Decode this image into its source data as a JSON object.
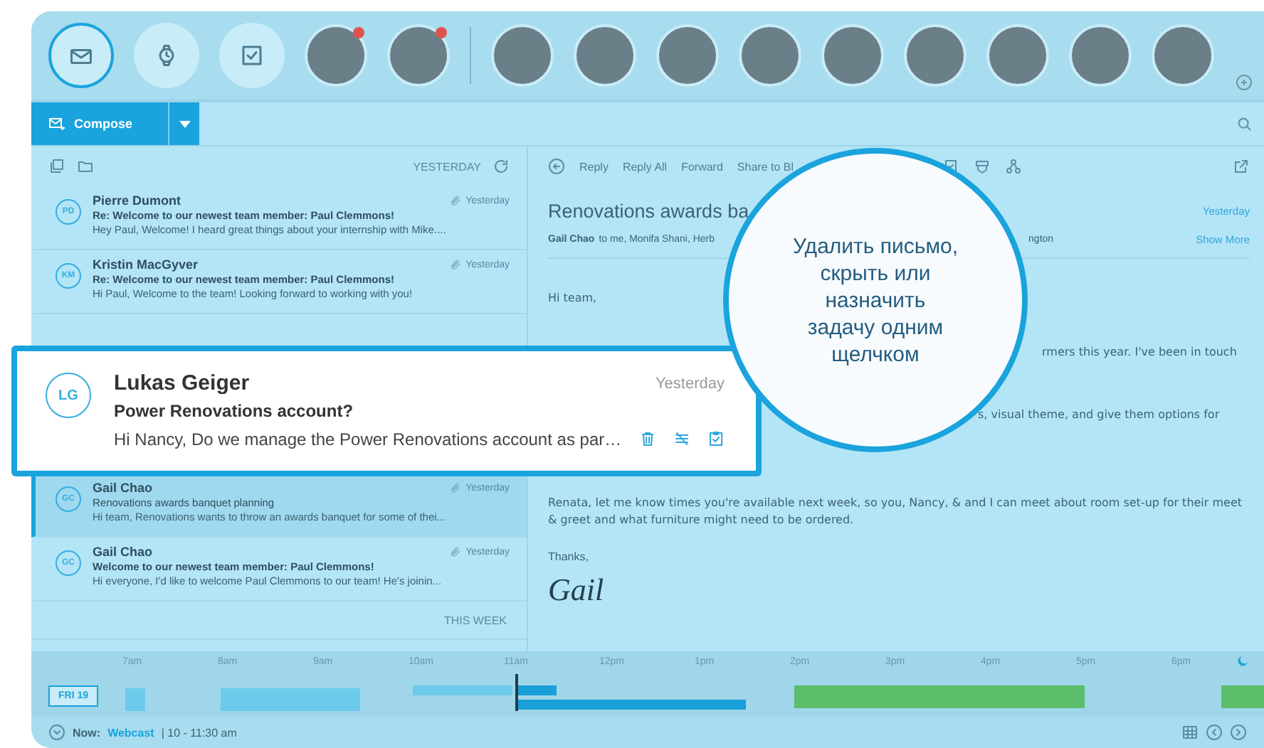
{
  "top_bar": {
    "views": [
      {
        "kind": "mail",
        "selected": true
      },
      {
        "kind": "clock",
        "selected": false
      },
      {
        "kind": "tasks",
        "selected": false
      }
    ],
    "pinned_people": [
      {
        "notification": true
      },
      {
        "notification": true
      }
    ],
    "people": [
      {
        "notification": false
      },
      {
        "notification": false
      },
      {
        "notification": false
      },
      {
        "notification": false
      },
      {
        "notification": false
      },
      {
        "notification": false
      },
      {
        "notification": false
      },
      {
        "notification": false
      },
      {
        "notification": false
      }
    ]
  },
  "compose": {
    "label": "Compose"
  },
  "message_list": {
    "header": "YESTERDAY",
    "items": [
      {
        "kind": "message",
        "initials": "PD",
        "sender": "Pierre Dumont",
        "subject": "Re: Welcome to our newest team member: Paul Clemmons!",
        "preview": "Hey Paul, Welcome! I heard great things about your internship with Mike....",
        "time": "Yesterday",
        "unread": true,
        "selected": false
      },
      {
        "kind": "message",
        "initials": "KM",
        "sender": "Kristin MacGyver",
        "subject": "Re: Welcome to our newest team member: Paul Clemmons!",
        "preview": "Hi Paul, Welcome to the team! Looking forward to working with you!",
        "time": "Yesterday",
        "unread": true,
        "selected": false
      },
      {
        "kind": "message",
        "initials": "GC",
        "sender": "Gail Chao",
        "subject": "Renovations awards banquet planning",
        "preview": "Hi team, Renovations wants to throw an awards banquet for some of thei...",
        "time": "Yesterday",
        "unread": false,
        "selected": true
      },
      {
        "kind": "message",
        "initials": "GC",
        "sender": "Gail Chao",
        "subject": "Welcome to our newest team member: Paul Clemmons!",
        "preview": "Hi everyone, I'd like to welcome Paul Clemmons to our team! He's joinin...",
        "time": "Yesterday",
        "unread": true,
        "selected": false
      },
      {
        "kind": "heading",
        "label": "THIS WEEK"
      }
    ]
  },
  "popup_card": {
    "initials": "LG",
    "sender": "Lukas Geiger",
    "subject": "Power Renovations account?",
    "preview": "Hi Nancy, Do we manage the Power Renovations account as par…",
    "time": "Yesterday"
  },
  "reading_pane": {
    "actions": [
      "Reply",
      "Reply All",
      "Forward",
      "Share to Bl"
    ],
    "subject": "Renovations awards ba",
    "time": "Yesterday",
    "from": "Gail Chao",
    "recipients": "to me, Monifa Shani, Herb",
    "recipients_end": "ngton",
    "show_more": "Show More",
    "greeting": "Hi team,",
    "fragments": [
      "rmers this year. I've been in touch",
      "s, visual theme, and give them options for"
    ],
    "paragraph": "Renata, let me know times you're available next week, so you, Nancy, & and I can meet about room set-up for their meet & greet and what furniture might need to be ordered.",
    "closing": "Thanks,",
    "signature": "Gail"
  },
  "callout": {
    "text": "Удалить письмо,\nскрыть или\nназначить\nзадачу одним\nщелчком"
  },
  "timeline": {
    "hours": [
      "7am",
      "8am",
      "9am",
      "10am",
      "11am",
      "12pm",
      "1pm",
      "2pm",
      "3pm",
      "4pm",
      "5pm",
      "6pm"
    ],
    "day": "FRI 19",
    "events": [
      {
        "color": "#6ccbea"
      },
      {
        "color": "#6ccbea"
      },
      {
        "color": "#6ccbea"
      },
      {
        "color": "#1a9fd8"
      },
      {
        "color": "#1a9fd8"
      },
      {
        "color": "#5cbd6a"
      },
      {
        "color": "#5cbd6a"
      }
    ]
  },
  "status_bar": {
    "now_label": "Now:",
    "event": "Webcast",
    "time": "| 10 - 11:30 am"
  }
}
